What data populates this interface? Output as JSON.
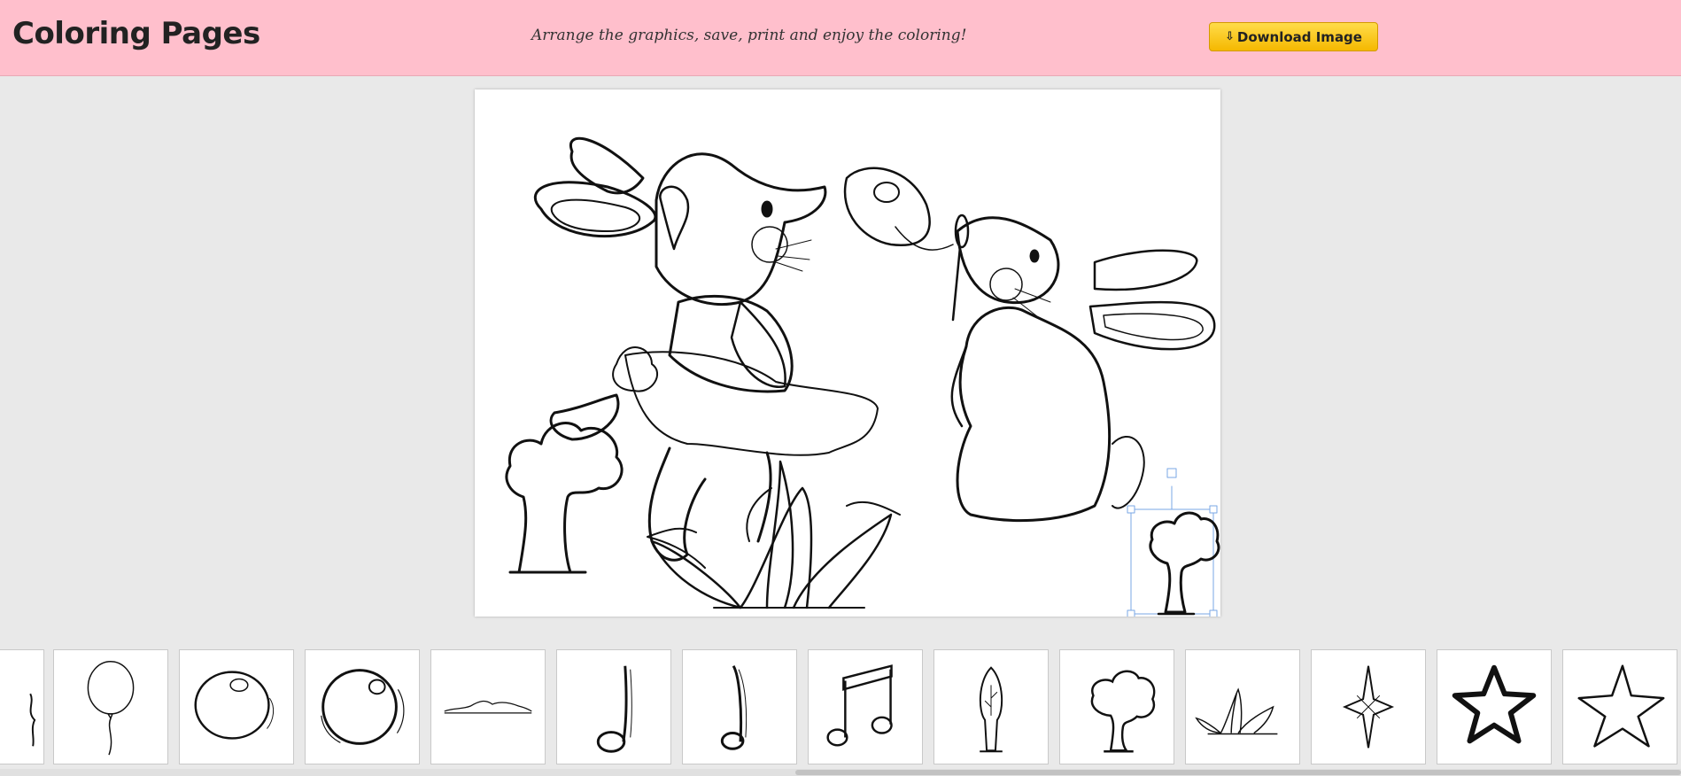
{
  "header": {
    "title": "Coloring Pages",
    "tagline": "Arrange the graphics, save, print and enjoy the coloring!",
    "download_label": "Download Image",
    "download_icon": "⇩"
  },
  "colors": {
    "header_bg": "#ffbfcc",
    "button_bg": "#f5b800",
    "selection": "#7aa7e6"
  },
  "canvas": {
    "items": [
      "bunny-ballerina",
      "bunny-blowing-bubble",
      "tree",
      "bush",
      "tree-selected"
    ]
  },
  "tray": {
    "items": [
      "cut-off-item",
      "balloon",
      "bubble",
      "bubble-large",
      "grass-strip",
      "music-note",
      "music-note-thin",
      "double-music-note",
      "tall-tree",
      "tree",
      "bush",
      "compass-star",
      "star-bold",
      "star-outline"
    ]
  }
}
